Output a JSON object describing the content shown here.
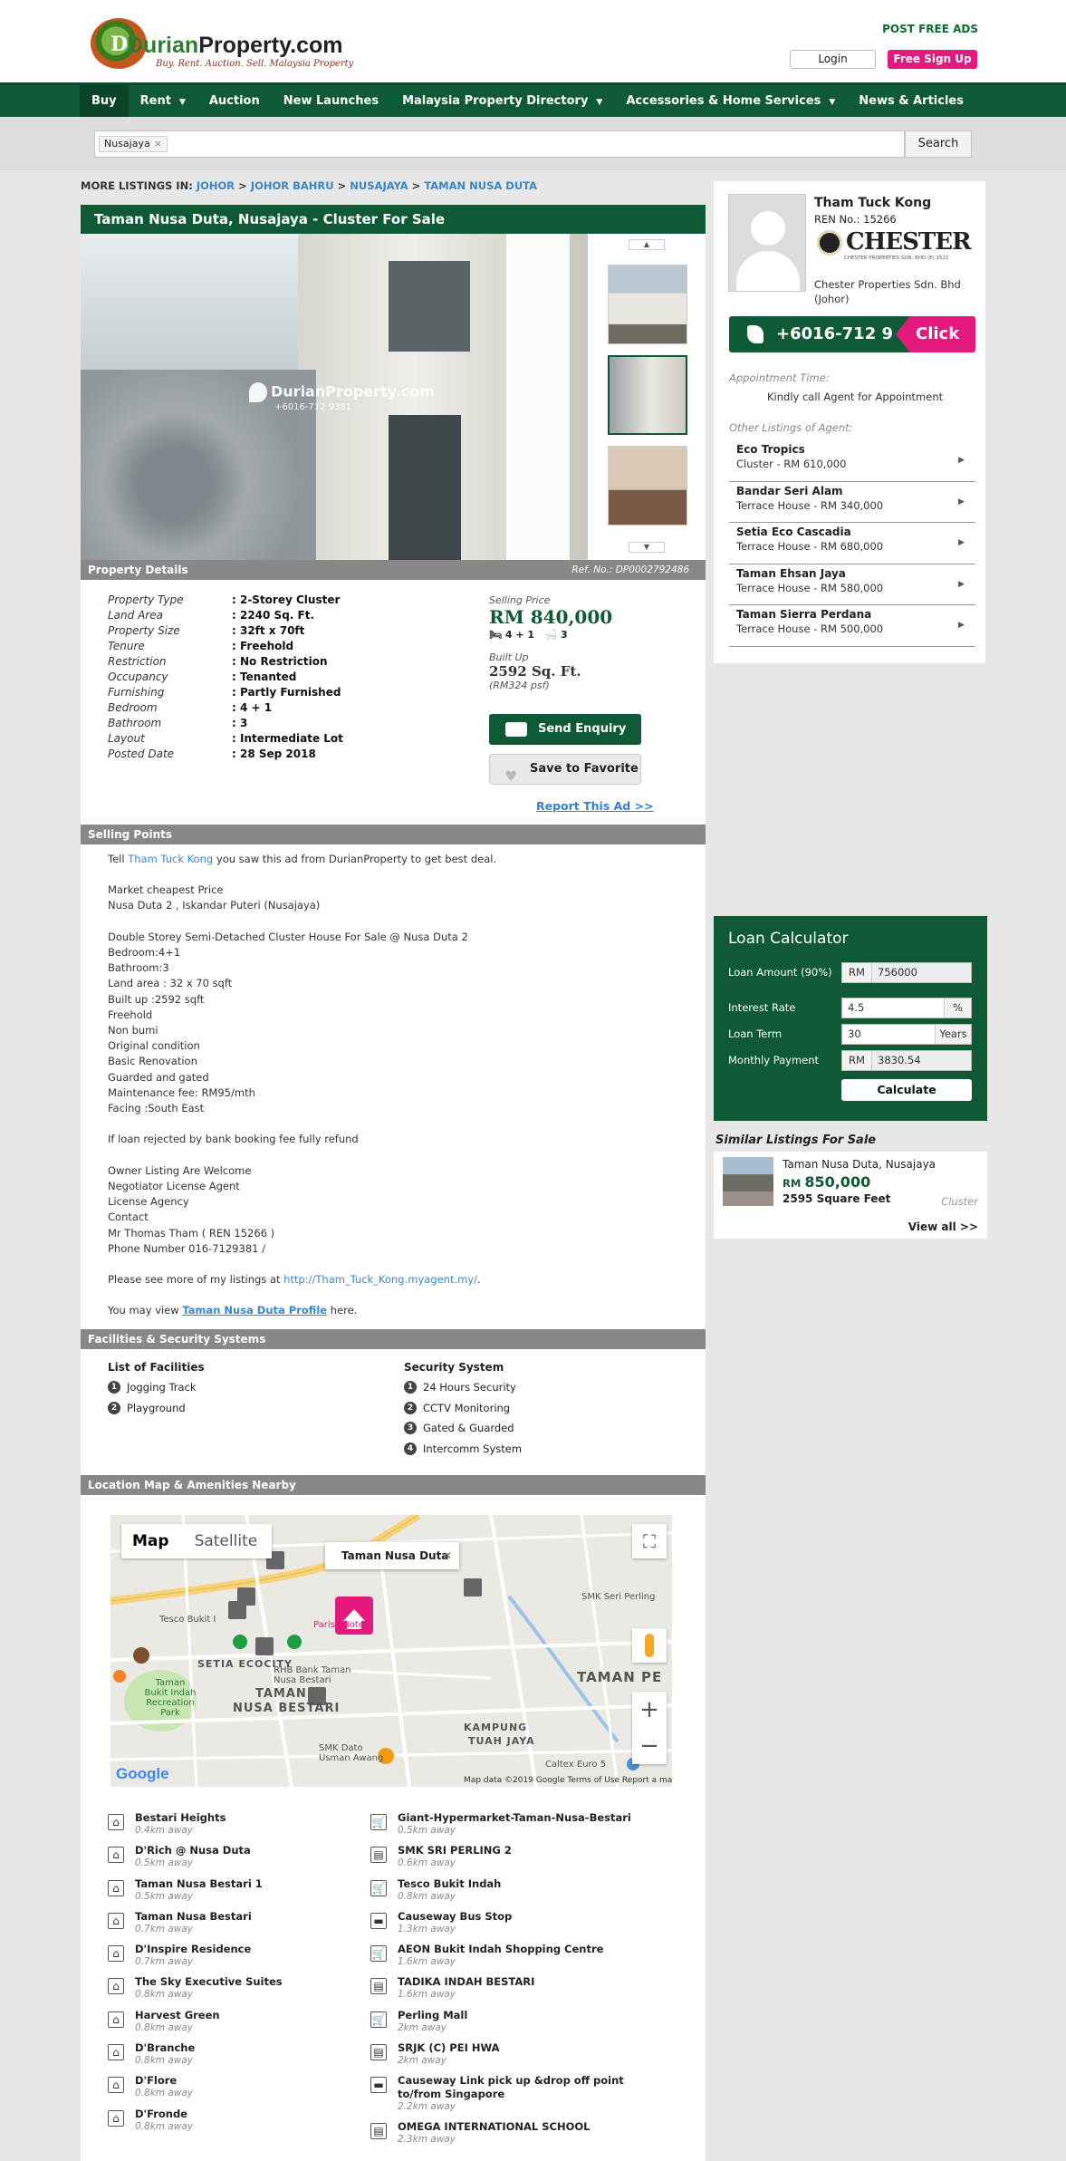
{
  "header": {
    "logo_text_1": "Durian",
    "logo_text_2": "Property.com",
    "logo_tagline": "Buy. Rent. Auction. Sell. Malaysia Property",
    "post_free_ads": "POST FREE ADS",
    "login": "Login",
    "signup": "Free Sign Up"
  },
  "nav": {
    "items": [
      "Buy",
      "Rent",
      "Auction",
      "New Launches",
      "Malaysia Property Directory",
      "Accessories & Home Services",
      "News & Articles"
    ]
  },
  "search": {
    "chip": "Nusajaya",
    "chip_remove": "×",
    "button": "Search"
  },
  "breadcrumb": {
    "prefix": "MORE LISTINGS IN:",
    "items": [
      "JOHOR",
      "JOHOR BAHRU",
      "NUSAJAYA",
      "TAMAN NUSA DUTA"
    ],
    "sep": ">"
  },
  "listing": {
    "title": "Taman Nusa Duta, Nusajaya - Cluster For Sale",
    "watermark": "DurianProperty.com",
    "watermark_phone": "+6016-712 9381",
    "details_header": "Property Details",
    "ref": "Ref. No.: DP0002792486",
    "details": [
      {
        "k": "Property Type",
        "v": ": 2-Storey Cluster"
      },
      {
        "k": "Land Area",
        "v": ": 2240 Sq. Ft."
      },
      {
        "k": "Property Size",
        "v": ": 32ft x 70ft"
      },
      {
        "k": "Tenure",
        "v": ": Freehold"
      },
      {
        "k": "Restriction",
        "v": ": No Restriction"
      },
      {
        "k": "Occupancy",
        "v": ": Tenanted"
      },
      {
        "k": "Furnishing",
        "v": ": Partly Furnished"
      },
      {
        "k": "Bedroom",
        "v": ": 4 + 1"
      },
      {
        "k": "Bathroom",
        "v": ": 3"
      },
      {
        "k": "Layout",
        "v": ": Intermediate Lot"
      },
      {
        "k": "Posted Date",
        "v": ": 28 Sep 2018"
      }
    ],
    "price_label": "Selling Price",
    "price": "RM 840,000",
    "beds": "4 + 1",
    "baths": "3",
    "builtup_label": "Built Up",
    "builtup": "2592 Sq. Ft.",
    "psf": "(RM324 psf)",
    "enquiry": "Send Enquiry",
    "favorite": "Save to Favorite",
    "report": "Report This Ad >>"
  },
  "selling_points": {
    "header": "Selling Points",
    "tell_pre": "Tell",
    "tell_agent": "Tham Tuck Kong",
    "tell_post": "you saw this ad from DurianProperty to get best deal.",
    "lines": [
      "Market cheapest Price",
      "Nusa Duta 2 , Iskandar Puteri (Nusajaya)",
      "",
      "Double Storey Semi-Detached Cluster House For Sale @ Nusa Duta 2",
      "Bedroom:4+1",
      "Bathroom:3",
      "Land area : 32 x 70 sqft",
      "Built up :2592 sqft",
      "Freehold",
      "Non bumi",
      "Original condition",
      "Basic Renovation",
      "Guarded and gated",
      "Maintenance fee: RM95/mth",
      "Facing :South East",
      "",
      "If loan rejected by bank booking fee fully refund",
      "",
      "Owner Listing Are Welcome",
      "Negotiator License Agent",
      "License Agency",
      "Contact",
      "Mr Thomas Tham ( REN 15266 )",
      "Phone Number 016-7129381 /"
    ],
    "more_pre": "Please see more of my listings at",
    "more_link": "http://Tham_Tuck_Kong.myagent.my/",
    "more_post": ".",
    "profile_pre": "You may view",
    "profile_link": "Taman Nusa Duta Profile",
    "profile_post": "here."
  },
  "facilities": {
    "header": "Facilities & Security Systems",
    "list_title": "List of Facilities",
    "list": [
      "Jogging Track",
      "Playground"
    ],
    "security_title": "Security System",
    "security": [
      "24 Hours Security",
      "CCTV Monitoring",
      "Gated & Guarded",
      "Intercomm System"
    ]
  },
  "map": {
    "header": "Location Map & Amenities Nearby",
    "type_map": "Map",
    "type_satellite": "Satellite",
    "infowindow": "Taman Nusa Duta",
    "labels": [
      "TAMAN PE",
      "TAMAN",
      "NUSA BESTARI",
      "SETIA ECOCITY",
      "KAMPUNG",
      "TUAH JAYA",
      "Taman Bukit Indah Recreation Park",
      "Tesco Bukit I",
      "RHB Bank Taman Nusa Bestari",
      "SMK Seri Perling",
      "SMK Dato Usman Awang",
      "Pariss Hote",
      "Caltex Euro 5"
    ],
    "attribution": "Map data ©2019 Google    Terms of Use    Report a map error",
    "google": "Google"
  },
  "amenities": {
    "left": [
      {
        "name": "Bestari Heights",
        "dist": "0.4km away",
        "icon": "house-icon"
      },
      {
        "name": "D'Rich @ Nusa Duta",
        "dist": "0.5km away",
        "icon": "house-icon"
      },
      {
        "name": "Taman Nusa Bestari 1",
        "dist": "0.5km away",
        "icon": "house-icon"
      },
      {
        "name": "Taman Nusa Bestari",
        "dist": "0.7km away",
        "icon": "house-icon"
      },
      {
        "name": "D'Inspire Residence",
        "dist": "0.7km away",
        "icon": "house-icon"
      },
      {
        "name": "The Sky Executive Suites",
        "dist": "0.8km away",
        "icon": "house-icon"
      },
      {
        "name": "Harvest Green",
        "dist": "0.8km away",
        "icon": "house-icon"
      },
      {
        "name": "D'Branche",
        "dist": "0.8km away",
        "icon": "house-icon"
      },
      {
        "name": "D'Flore",
        "dist": "0.8km away",
        "icon": "house-icon"
      },
      {
        "name": "D'Fronde",
        "dist": "0.8km away",
        "icon": "house-icon"
      }
    ],
    "right": [
      {
        "name": "Giant-Hypermarket-Taman-Nusa-Bestari",
        "dist": "0.5km away",
        "icon": "cart-icon"
      },
      {
        "name": "SMK SRI PERLING 2",
        "dist": "0.6km away",
        "icon": "school-icon"
      },
      {
        "name": "Tesco Bukit Indah",
        "dist": "0.8km away",
        "icon": "cart-icon"
      },
      {
        "name": "Causeway Bus Stop",
        "dist": "1.3km away",
        "icon": "bus-icon"
      },
      {
        "name": "AEON Bukit Indah Shopping Centre",
        "dist": "1.6km away",
        "icon": "cart-icon"
      },
      {
        "name": "TADIKA INDAH BESTARI",
        "dist": "1.6km away",
        "icon": "school-icon"
      },
      {
        "name": "Perling Mall",
        "dist": "2km away",
        "icon": "cart-icon"
      },
      {
        "name": "SRJK (C) PEI HWA",
        "dist": "2km away",
        "icon": "school-icon"
      },
      {
        "name": "Causeway Link pick up &drop off point to/from Singapore",
        "dist": "2.2km away",
        "icon": "bus-icon"
      },
      {
        "name": "OMEGA INTERNATIONAL SCHOOL",
        "dist": "2.3km away",
        "icon": "school-icon"
      }
    ]
  },
  "agent": {
    "name": "Tham Tuck Kong",
    "ren": "REN No.: 15266",
    "company_logo": "CHESTER",
    "company_logo_sub": "CHESTER PROPERTIES SDN. BHD (E) 1521",
    "company": "Chester Properties Sdn. Bhd (Johor)",
    "phone": "+6016-712 9",
    "click": "Click",
    "appt_label": "Appointment Time:",
    "appt": "Kindly call Agent for Appointment",
    "other_label": "Other Listings of Agent:",
    "other": [
      {
        "name": "Eco Tropics",
        "desc": "Cluster - RM 610,000"
      },
      {
        "name": "Bandar Seri Alam",
        "desc": "Terrace House - RM 340,000"
      },
      {
        "name": "Setia Eco Cascadia",
        "desc": "Terrace House - RM 680,000"
      },
      {
        "name": "Taman Ehsan Jaya",
        "desc": "Terrace House - RM 580,000"
      },
      {
        "name": "Taman Sierra Perdana",
        "desc": "Terrace House - RM 500,000"
      }
    ]
  },
  "loan": {
    "title": "Loan Calculator",
    "amount_label": "Loan Amount (90%)",
    "amount_prefix": "RM",
    "amount": "756000",
    "rate_label": "Interest Rate",
    "rate": "4.5",
    "rate_suffix": "%",
    "term_label": "Loan Term",
    "term": "30",
    "term_suffix": "Years",
    "payment_label": "Monthly Payment",
    "payment_prefix": "RM",
    "payment": "3830.54",
    "calculate": "Calculate"
  },
  "similar": {
    "header": "Similar Listings For Sale",
    "title": "Taman Nusa Duta, Nusajaya",
    "price_prefix": "RM",
    "price": "850,000",
    "size": "2595 Square Feet",
    "type": "Cluster",
    "view_all": "View all >>"
  },
  "colors": {
    "brand_green": "#0d5a35",
    "pink": "#e4197d",
    "link_blue": "#3a87c7"
  }
}
